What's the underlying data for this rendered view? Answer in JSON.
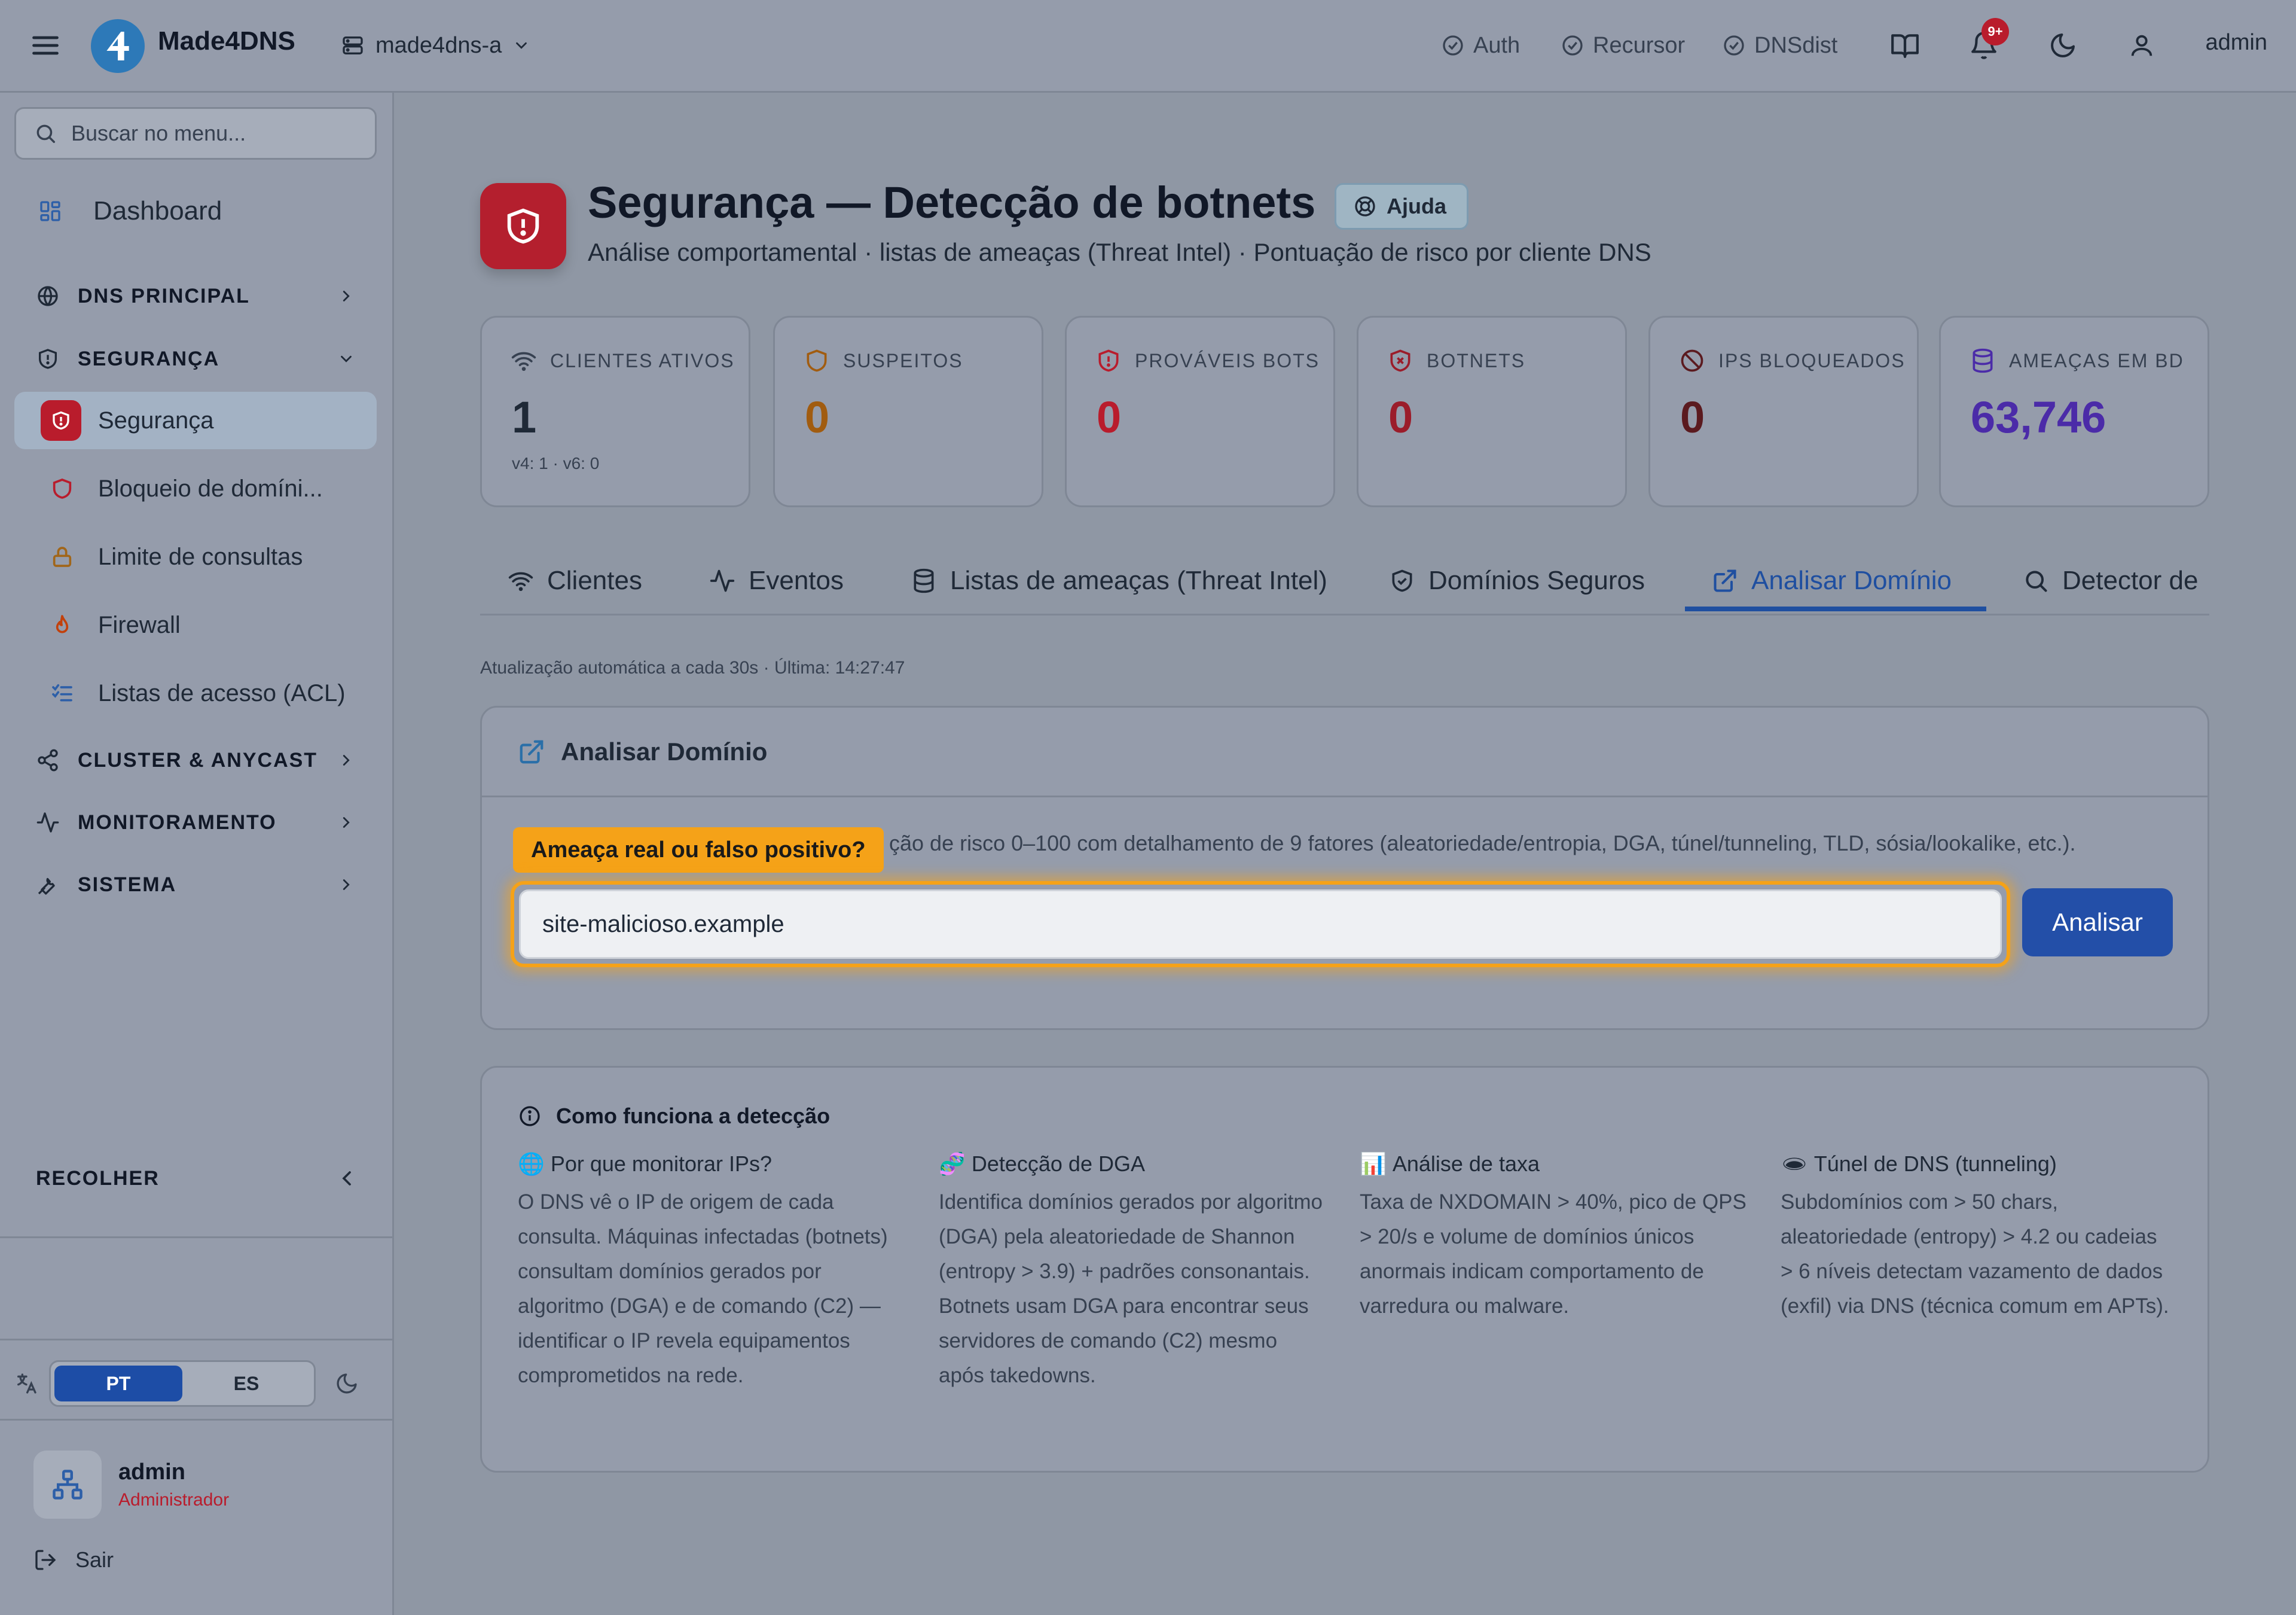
{
  "topbar": {
    "brand": "Made4DNS",
    "server": "made4dns-a",
    "status": [
      "Auth",
      "Recursor",
      "DNSdist"
    ],
    "notifications_badge": "9+",
    "user": "admin"
  },
  "sidebar": {
    "search_placeholder": "Buscar no menu...",
    "dashboard": "Dashboard",
    "sections": {
      "dns": "DNS PRINCIPAL",
      "security": "SEGURANÇA",
      "cluster": "CLUSTER & ANYCAST",
      "monitoring": "MONITORAMENTO",
      "system": "SISTEMA"
    },
    "security_items": [
      "Segurança",
      "Bloqueio de domíni...",
      "Limite de consultas",
      "Firewall",
      "Listas de acesso (ACL)"
    ],
    "collapse": "RECOLHER",
    "lang": [
      "PT",
      "ES"
    ],
    "user_name": "admin",
    "user_role": "Administrador",
    "logout": "Sair"
  },
  "page": {
    "title": "Segurança — Detecção de botnets",
    "help": "Ajuda",
    "subtitle": "Análise comportamental · listas de ameaças (Threat Intel) · Pontuação de risco por cliente DNS"
  },
  "stats": [
    {
      "label": "CLIENTES ATIVOS",
      "value": "1",
      "sub": "v4: 1 · v6: 0",
      "color": "#1f2937"
    },
    {
      "label": "SUSPEITOS",
      "value": "0",
      "color": "#a15c10"
    },
    {
      "label": "PROVÁVEIS BOTS",
      "value": "0",
      "color": "#b91c2c"
    },
    {
      "label": "BOTNETS",
      "value": "0",
      "color": "#9b1c2a"
    },
    {
      "label": "IPS BLOQUEADOS",
      "value": "0",
      "color": "#5b1a1f"
    },
    {
      "label": "AMEAÇAS EM BD",
      "value": "63,746",
      "color": "#4b2ba8"
    }
  ],
  "tabs": [
    "Clientes",
    "Eventos",
    "Listas de ameaças (Threat Intel)",
    "Domínios Seguros",
    "Analisar Domínio",
    "Detector de"
  ],
  "auto_update": "Atualização automática a cada 30s · Última: 14:27:47",
  "analyze": {
    "title": "Analisar Domínio",
    "description": "ção de risco 0–100 com detalhamento de 9 fatores (aleatoriedade/entropia, DGA, túnel/tunneling, TLD, sósia/lookalike, etc.).",
    "tooltip": "Ameaça real ou falso positivo?",
    "input_value": "site-malicioso.example",
    "button": "Analisar"
  },
  "how": {
    "title": "Como funciona a detecção",
    "columns": [
      {
        "emoji": "🌐",
        "title": "Por que monitorar IPs?",
        "text": "O DNS vê o IP de origem de cada consulta. Máquinas infectadas (botnets) consultam domínios gerados por algoritmo (DGA) e de comando (C2) — identificar o IP revela equipamentos comprometidos na rede."
      },
      {
        "emoji": "🧬",
        "title": "Detecção de DGA",
        "text": "Identifica domínios gerados por algoritmo (DGA) pela aleatoriedade de Shannon (entropy > 3.9) + padrões consonantais. Botnets usam DGA para encontrar seus servidores de comando (C2) mesmo após takedowns."
      },
      {
        "emoji": "📊",
        "title": "Análise de taxa",
        "text": "Taxa de NXDOMAIN > 40%, pico de QPS > 20/s e volume de domínios únicos anormais indicam comportamento de varredura ou malware."
      },
      {
        "emoji": "🕳",
        "title": "Túnel de DNS (tunneling)",
        "text": "Subdomínios com > 50 chars, aleatoriedade (entropy) > 4.2 ou cadeias > 6 níveis detectam vazamento de dados (exfil) via DNS (técnica comum em APTs)."
      }
    ]
  }
}
